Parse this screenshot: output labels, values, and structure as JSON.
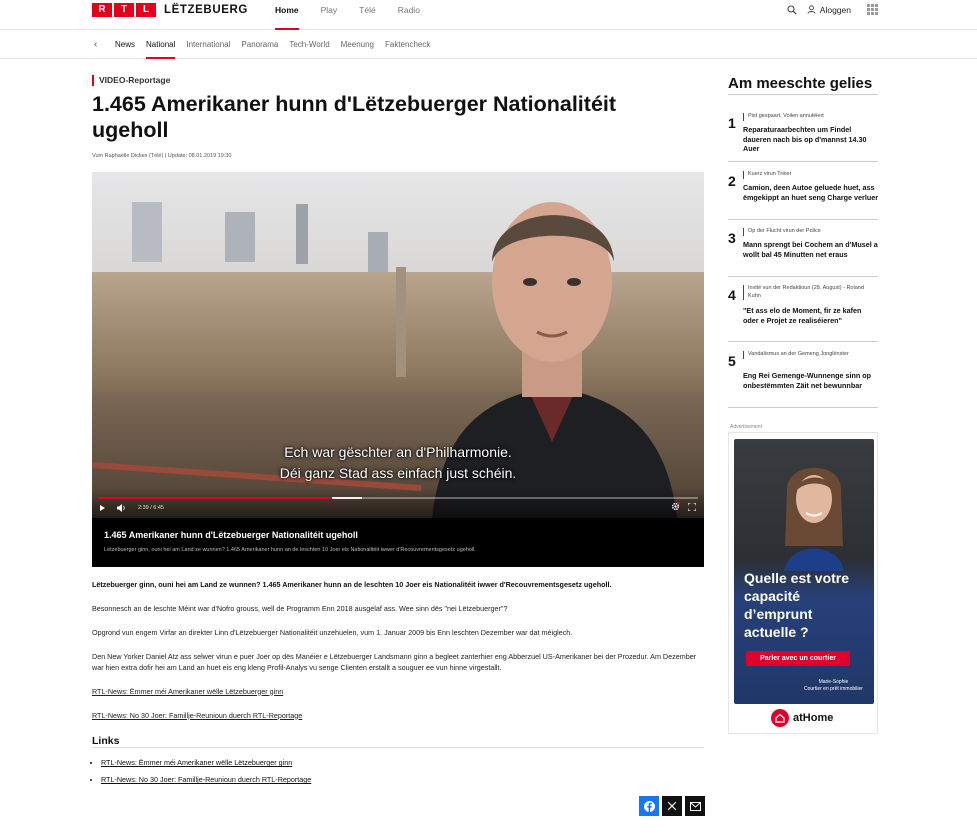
{
  "header": {
    "logo_letters": [
      "R",
      "T",
      "L"
    ],
    "logo_word": "LËTZEBUERG",
    "nav": [
      "Home",
      "Play",
      "Télé",
      "Radio"
    ],
    "login_label": "Aloggen"
  },
  "subnav": {
    "items": [
      "News",
      "National",
      "International",
      "Panorama",
      "Tech-World",
      "Meenung",
      "Faktencheck"
    ]
  },
  "article": {
    "kicker": "VIDEO-Reportage",
    "title": "1.465 Amerikaner hunn d'Lëtzebuerger Nationalitéit ugeholl",
    "byline": "Vum Raphaëlle Dickes (Télé)  |  Update: 08.01.2019 19:30",
    "video": {
      "subtitle_line1": "Ech war gëschter an d'Philharmonie.",
      "subtitle_line2": "Déi ganz Stad ass einfach just schéin.",
      "time": "2:39  /  6:45",
      "progress_played": 0.39,
      "progress_buffered_start": 0.39,
      "progress_buffered_end": 0.44,
      "caption_title": "1.465 Amerikaner hunn d'Lëtzebuerger Nationalitéit ugeholl",
      "caption_desc": "Lëtzebuerger ginn, ouni hei am Land ze wunnen? 1.465 Amerikaner hunn an de leschten 10 Joer eis Nationalitéit iwwer d'Recouvrementsgesetz ugeholl."
    },
    "paragraphs": {
      "lead": "Lëtzebuerger ginn, ouni hei am Land ze wunnen? 1.465 Amerikaner hunn an de leschten 10 Joer eis Nationalitéit iwwer d'Recouvrementsgesetz ugeholl.",
      "p1": "Besonnesch an de leschte Méint war d'Nofro grouss, well de Programm Enn 2018 ausgelaf ass. Wee sinn dës \"nei Lëtzebuerger\"?",
      "p2": "Opgrond vun engem Virfar an direkter Linn d'Lëtzebuerger Nationalitéit unzehuelen, vum 1. Januar 2009 bis Enn leschten Dezember war dat méiglech.",
      "p3": "Den New Yorker Daniel Atz ass selwer virun e puer Joer op dës Manéier e Lëtzebuerger Landsmann ginn a begleet zanterhier eng Abberzuel US-Amerikaner bei der Prozedur. Am Dezember war hien extra dofir hei am Land an huet eis eng kleng Profil-Analys vu senge Clienten erstallt a souguer ee vun hinne virgestallt.",
      "link1": "RTL-News: Ëmmer méi Amerikaner wëlle Lëtzebuerger ginn",
      "link2": "RTL-News: No 30 Joer: Famillje-Reunioun duerch RTL-Reportage"
    },
    "links_heading": "Links",
    "links": [
      "RTL-News: Ëmmer méi Amerikaner wëlle Lëtzebuerger ginn",
      "RTL-News: No 30 Joer: Famillje-Reunioun duerch RTL-Reportage"
    ]
  },
  "sidebar": {
    "heading": "Am meeschte gelies",
    "items": [
      {
        "num": "1",
        "cat": "Pist gespaart, Voilen annuléiert",
        "headline": "Reparaturaarbechten um Findel daueren nach bis op d'mannst 14.30 Auer"
      },
      {
        "num": "2",
        "cat": "Kuerz virun Tréier",
        "headline": "Camion, deen Autoe geluede huet, ass ëmgekippt an huet seng Charge verluer"
      },
      {
        "num": "3",
        "cat": "Op der Flucht virun der Police",
        "headline": "Mann sprengt bei Cochem an d'Musel a wollt bal 45 Minutten net eraus"
      },
      {
        "num": "4",
        "cat": "Invité vun der Redaktioun (28. August) - Roland Kuhn",
        "headline": "\"Et ass elo de Moment, fir ze kafen oder e Projet ze realiséieren\""
      },
      {
        "num": "5",
        "cat": "Vandalismus an der Gemeng Jonglënster",
        "headline": "Eng Rei Gemenge-Wunnenge sinn op onbestëmmten Zäit net bewunnbar"
      }
    ],
    "ad": {
      "label": "Advertisement",
      "headline": "Quelle est votre capacité d’emprunt actuelle ?",
      "cta": "Parler avec un courtier",
      "sig_name": "Marie-Sophie",
      "sig_role": "Courtier en prêt immobilier",
      "brand": "atHome"
    }
  },
  "colors": {
    "accent": "#e2001a",
    "facebook": "#1877f2"
  }
}
